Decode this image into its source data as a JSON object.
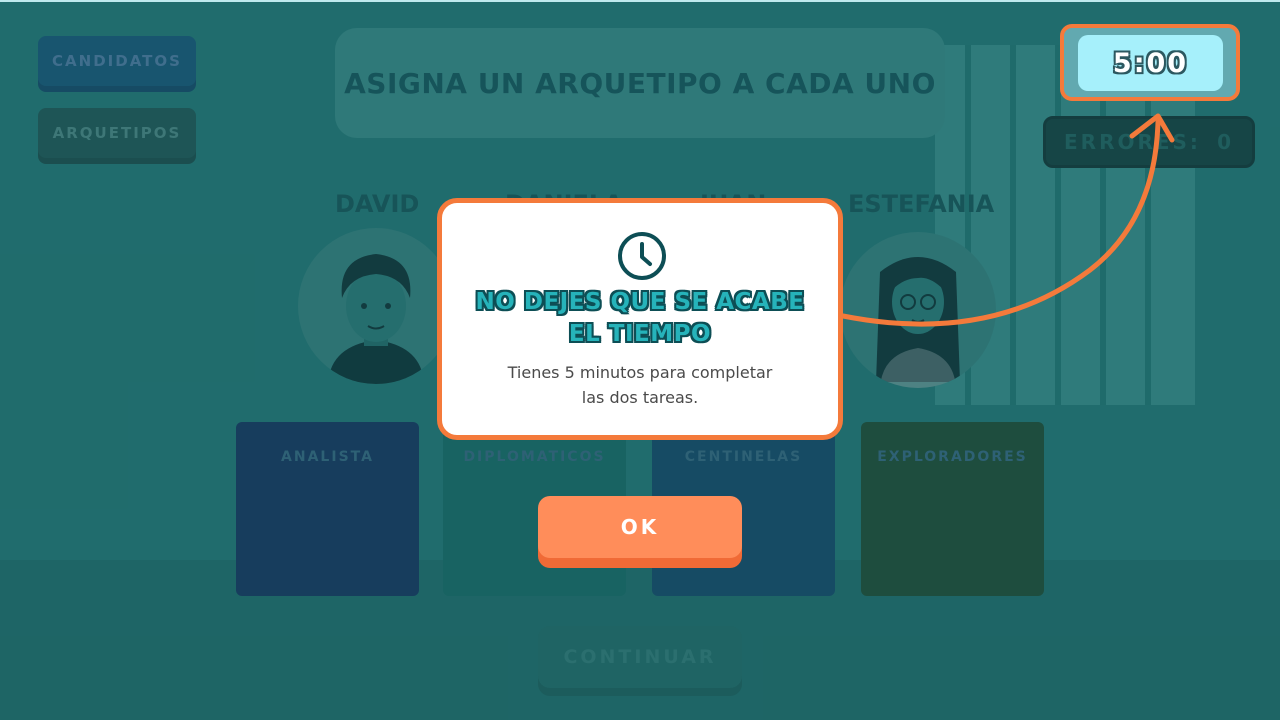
{
  "sidebar": {
    "candidatos_label": "CANDIDATOS",
    "arquetipos_label": "ARQUETIPOS"
  },
  "instruction": "ASIGNA UN ARQUETIPO A CADA UNO",
  "timer": "5:00",
  "errors": {
    "label": "ERRORES:",
    "count": "0"
  },
  "candidates": [
    {
      "name": "DAVID"
    },
    {
      "name": "DANIELA"
    },
    {
      "name": "JUAN"
    },
    {
      "name": "ESTEFANIA"
    }
  ],
  "archetypes": [
    {
      "label": "ANALISTA",
      "color": "#1c3f79"
    },
    {
      "label": "DIPLOMATICOS",
      "color": "#1f8a82"
    },
    {
      "label": "CENTINELAS",
      "color": "#1a5a87"
    },
    {
      "label": "EXPLORADORES",
      "color": "#2b5e3a"
    }
  ],
  "continue_label": "CONTINUAR",
  "modal": {
    "title_line1": "NO DEJES QUE SE ACABE",
    "title_line2": "EL TIEMPO",
    "text_line1": "Tienes 5 minutos para completar",
    "text_line2": "las dos tareas.",
    "ok_label": "OK"
  },
  "colors": {
    "accent_orange": "#f47a3b",
    "ok_button": "#ff8d5a",
    "background": "#2f9d98",
    "timer_bg": "#a6f0fb"
  }
}
